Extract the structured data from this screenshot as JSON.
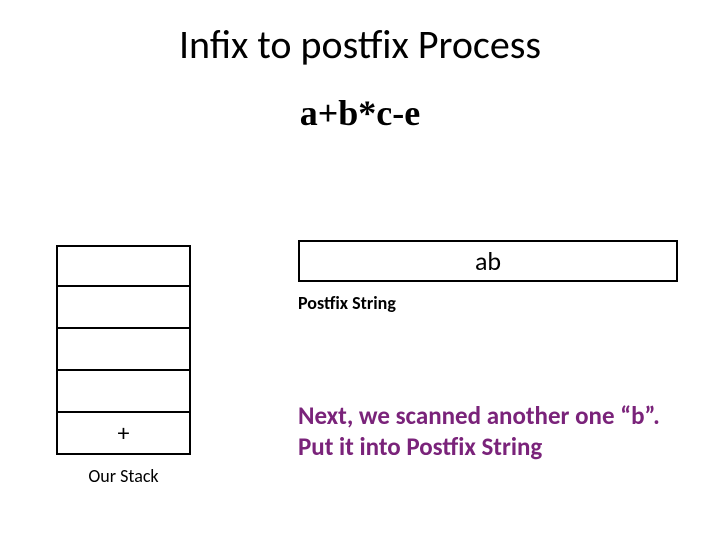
{
  "title": "Infix to postfix Process",
  "expression": "a+b*c-e",
  "stack": {
    "cells": [
      "",
      "",
      "",
      "",
      "+"
    ],
    "label": "Our Stack"
  },
  "postfix": {
    "value": "ab",
    "label": "Postfix String"
  },
  "explanation": "Next, we scanned another one “b”. Put it into Postfix String"
}
